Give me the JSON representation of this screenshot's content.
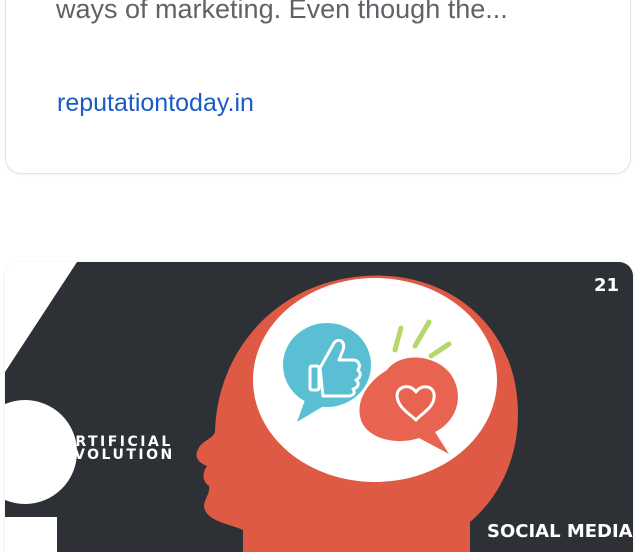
{
  "top_card": {
    "snippet": "ways of marketing. Even though the...",
    "source": "reputationtoday.in"
  },
  "bottom_card": {
    "image": {
      "slide_number": "21",
      "brand_line1": "ARTIFICIAL",
      "brand_line2": "EVOLUTION",
      "caption": "SOCIAL MEDIA"
    },
    "colors": {
      "background": "#2d3034",
      "head": "#df5a44",
      "bubble_blue": "#5bbfd4",
      "heart": "#e86450"
    }
  }
}
